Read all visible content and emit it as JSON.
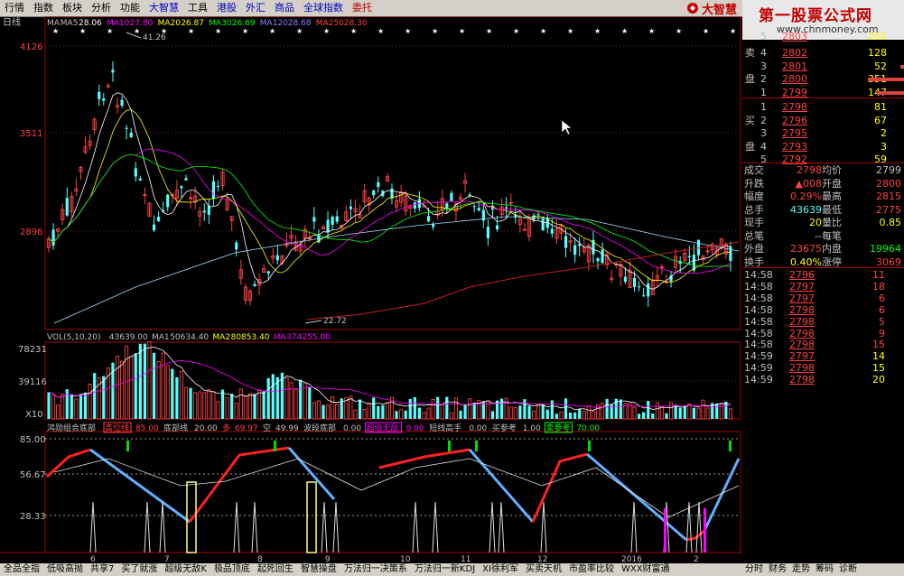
{
  "menu": {
    "items": [
      "行情",
      "指数",
      "板块",
      "分析",
      "功能",
      "大智慧",
      "工具",
      "港股",
      "外汇",
      "商品",
      "全球指数",
      "委托"
    ],
    "logo": "大智慧"
  },
  "brand": {
    "title": "第一股票公式网",
    "url": "www.chnmoney.com"
  },
  "chart": {
    "period": "日线",
    "ma_legend": [
      "MA",
      "MA5",
      "28.06",
      "MA10",
      "27.80",
      "MA20",
      "26.87",
      "MA30",
      "26.69",
      "MA120",
      "28.68",
      "MA250",
      "28.30"
    ],
    "y_labels": [
      "4126",
      "3511",
      "2896"
    ],
    "high_label": "41.26",
    "low_label": "22.72",
    "vol_legend": [
      "VOL(5,10,20)",
      "43639.00",
      "MA1",
      "50634.40",
      "MA2",
      "80853.40",
      "MA3",
      "74255.00"
    ],
    "vol_y_labels": [
      "78231",
      "39116",
      "X10"
    ],
    "ind_legend": [
      "鸿勋组合底部",
      "高位线",
      "85.00",
      "底部线",
      "20.00",
      "多",
      "69.97",
      "空",
      "49.99",
      "波段底部",
      "0.00",
      "超级无敌",
      "0.00",
      "短线高手",
      "0.00",
      "买参考",
      "1.00",
      "卖参考",
      "70.00"
    ],
    "ind_y_labels": [
      "85.00",
      "56.67",
      "28.33"
    ],
    "x_labels": [
      "6",
      "7",
      "8",
      "9",
      "10",
      "11",
      "12",
      "2016",
      "2"
    ]
  },
  "orderbook": {
    "sell_label": [
      "卖",
      "盘"
    ],
    "buy_label": [
      "买",
      "盘"
    ],
    "sells": [
      {
        "lvl": "4",
        "price": "2802",
        "vol": "128"
      },
      {
        "lvl": "3",
        "price": "2801",
        "vol": "52"
      },
      {
        "lvl": "2",
        "price": "2800",
        "vol": "351"
      },
      {
        "lvl": "1",
        "price": "2799",
        "vol": "147"
      }
    ],
    "sell_top": {
      "lvl": "5",
      "price": "2803",
      "vol": "201"
    },
    "buys": [
      {
        "lvl": "1",
        "price": "2798",
        "vol": "81"
      },
      {
        "lvl": "2",
        "price": "2796",
        "vol": "67"
      },
      {
        "lvl": "3",
        "price": "2795",
        "vol": "2"
      },
      {
        "lvl": "4",
        "price": "2793",
        "vol": "3"
      },
      {
        "lvl": "5",
        "price": "2792",
        "vol": "59"
      }
    ],
    "stats": [
      [
        "成交",
        "2798",
        "均价",
        "2799"
      ],
      [
        "升跌",
        "▲008",
        "开盘",
        "2800"
      ],
      [
        "幅度",
        "0.29%",
        "最高",
        "2815"
      ],
      [
        "总手",
        "43639",
        "最低",
        "2775"
      ],
      [
        "现手",
        "20",
        "量比",
        "0.85"
      ],
      [
        "总笔",
        "--",
        "每笔",
        ""
      ],
      [
        "外盘",
        "23675",
        "内盘",
        "19964"
      ],
      [
        "换手",
        "0.40%",
        "涨停",
        "3069"
      ]
    ],
    "ticks": [
      [
        "14:58",
        "2796",
        "11"
      ],
      [
        "14:58",
        "2797",
        "18"
      ],
      [
        "14:58",
        "2797",
        "6"
      ],
      [
        "14:58",
        "2798",
        "6"
      ],
      [
        "14:58",
        "2798",
        "5"
      ],
      [
        "14:58",
        "2798",
        "9"
      ],
      [
        "14:58",
        "2798",
        "15"
      ],
      [
        "14:59",
        "2797",
        "14"
      ],
      [
        "14:59",
        "2798",
        "15"
      ],
      [
        "14:59",
        "2798",
        "20"
      ]
    ]
  },
  "bottom_tabs": [
    "全品全指",
    "低吸高抛",
    "共享7",
    "买了就涨",
    "超级无敌K",
    "极品顶底",
    "起死回生",
    "智慧操盘",
    "万法归一决策系",
    "万法归一新KDJ",
    "XI徐利军",
    "买卖天机",
    "市盈率比较",
    "WXX财富通"
  ],
  "right_tabs": [
    "分时",
    "财务",
    "走势",
    "筹码",
    "诊断"
  ]
}
